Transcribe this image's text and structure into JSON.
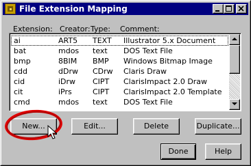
{
  "window": {
    "title": "File Extension Mapping",
    "controls": [
      "minimize",
      "maximize",
      "close"
    ]
  },
  "list": {
    "columns": [
      "Extension:",
      "Creator:",
      "Type:",
      "Comment:"
    ],
    "rows": [
      {
        "ext": "ai",
        "creator": "ART5",
        "type": "TEXT",
        "comment": "Illustrator 5.x Document"
      },
      {
        "ext": "bat",
        "creator": "mdos",
        "type": "text",
        "comment": "DOS Text File"
      },
      {
        "ext": "bmp",
        "creator": "8BIM",
        "type": "BMP",
        "comment": "Windows Bitmap Image"
      },
      {
        "ext": "cdd",
        "creator": "dDrw",
        "type": "CDrw",
        "comment": "Claris Draw"
      },
      {
        "ext": "cid",
        "creator": "iDrw",
        "type": "CIPT",
        "comment": "ClarisImpact 2.0 Draw"
      },
      {
        "ext": "cit",
        "creator": "iPrs",
        "type": "CIPT",
        "comment": "ClarisImpact 2.0 Template"
      },
      {
        "ext": "cmd",
        "creator": "mdos",
        "type": "text",
        "comment": "DOS Text File"
      }
    ]
  },
  "buttons": {
    "new": "New...",
    "edit": "Edit...",
    "delete": "Delete",
    "duplicate": "Duplicate...",
    "done": "Done",
    "help": "Help"
  },
  "colors": {
    "titlebar": "#000080",
    "highlight_circle": "#e00000",
    "face": "#c0c0c0"
  },
  "icons": {
    "app": "file-mapping-app-icon",
    "cursor": "arrow-cursor-icon"
  }
}
